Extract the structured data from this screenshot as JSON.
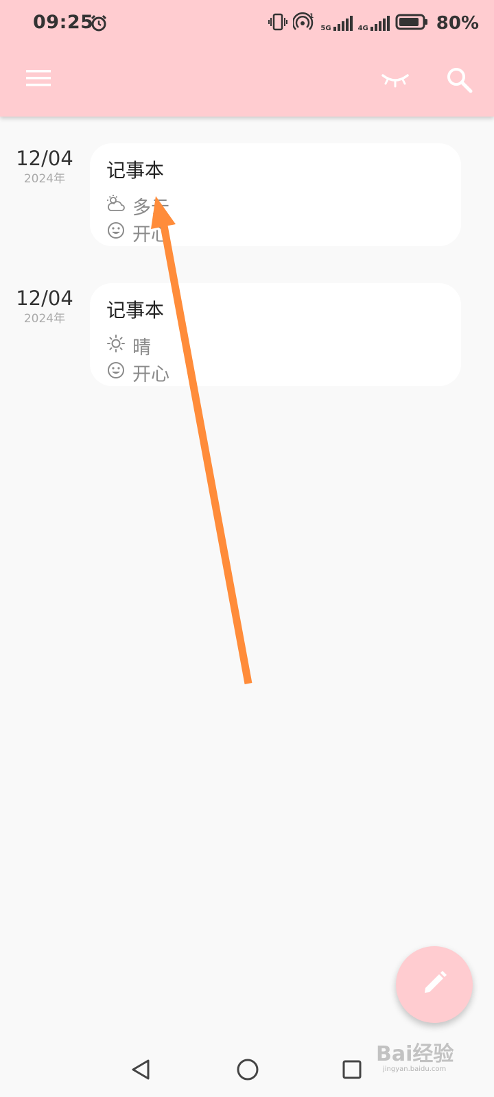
{
  "status_bar": {
    "time": "09:25",
    "battery_percent": "80%",
    "sim1_label": "5G",
    "sim2_label": "4G",
    "icons": [
      "alarm-icon",
      "vibrate-icon",
      "hotspot-icon",
      "signal-5g-icon",
      "signal-4g-icon",
      "battery-icon"
    ]
  },
  "app_bar": {
    "icons": [
      "menu-icon",
      "eye-closed-icon",
      "search-icon"
    ],
    "background_color": "#ffccd0"
  },
  "entries": [
    {
      "date": "12/04",
      "year": "2024年",
      "title": "记事本",
      "weather": "多云",
      "weather_icon": "cloudy-sun-icon",
      "mood": "开心",
      "mood_icon": "smile-icon"
    },
    {
      "date": "12/04",
      "year": "2024年",
      "title": "记事本",
      "weather": "晴",
      "weather_icon": "sun-icon",
      "mood": "开心",
      "mood_icon": "smile-icon"
    }
  ],
  "fab": {
    "icon": "pencil-icon"
  },
  "nav_bar": {
    "icons": [
      "back-icon",
      "home-icon",
      "recents-icon"
    ]
  },
  "watermark": {
    "text": "Bai经验",
    "url": "jingyan.baidu.com"
  },
  "annotation": {
    "arrow_color": "#ff8c3a"
  }
}
